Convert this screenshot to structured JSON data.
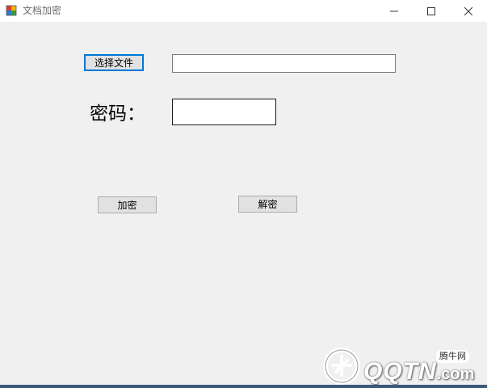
{
  "window": {
    "title": "文档加密"
  },
  "titlebar": {
    "controls": [
      "minimize-icon",
      "maximize-icon",
      "close-icon"
    ]
  },
  "form": {
    "select_file_label": "选择文件",
    "file_path_value": "",
    "password_label": "密码：",
    "password_value": "",
    "encrypt_label": "加密",
    "decrypt_label": "解密"
  },
  "watermark": {
    "brand": "QQTN",
    "suffix": ".com",
    "badge": "腾牛网"
  },
  "colors": {
    "background": "#f0f0f0",
    "focus_border": "#0078d7",
    "button_face": "#e1e1e1"
  }
}
